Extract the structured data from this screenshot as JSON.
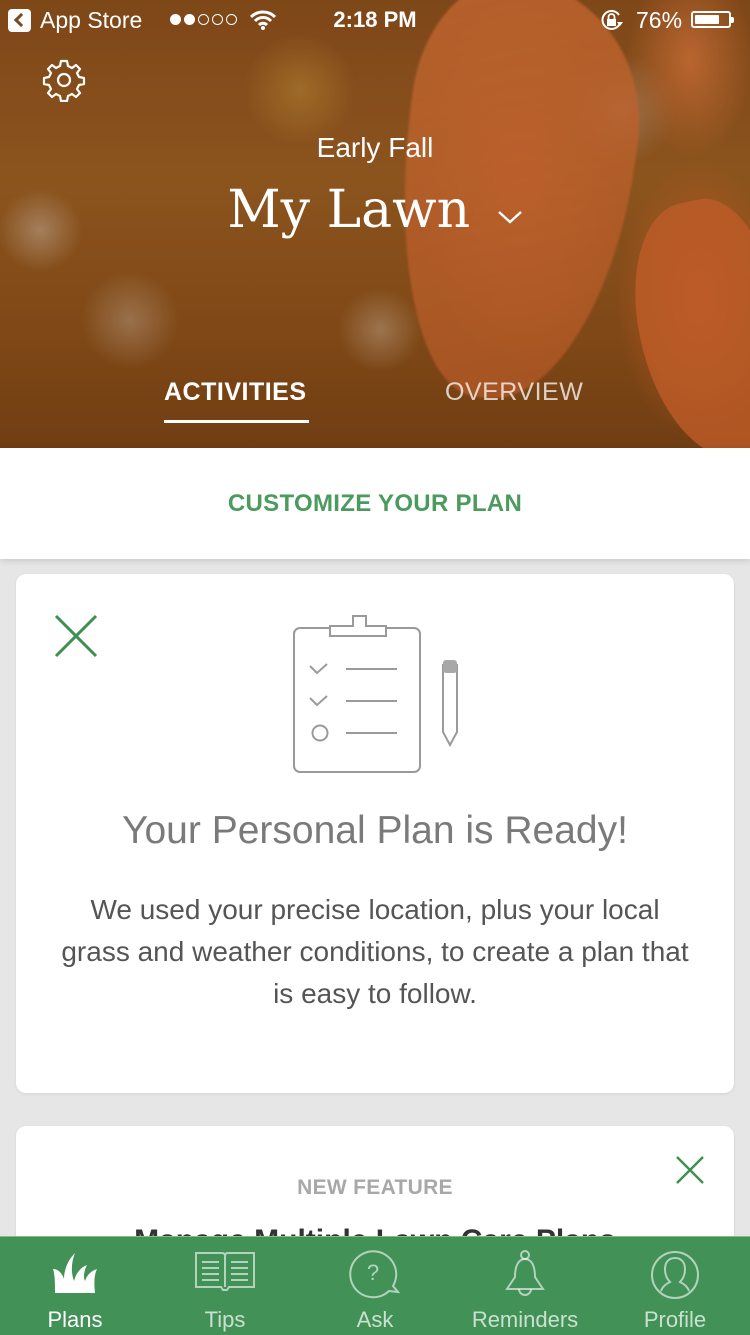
{
  "status_bar": {
    "back_label": "App Store",
    "signal_bars_filled": 2,
    "signal_bars_total": 5,
    "time": "2:18 PM",
    "battery_percent_label": "76%",
    "battery_level": 0.76
  },
  "header": {
    "season": "Early Fall",
    "title": "My Lawn",
    "tabs": [
      {
        "label": "ACTIVITIES",
        "active": true
      },
      {
        "label": "OVERVIEW",
        "active": false
      }
    ]
  },
  "customize_label": "CUSTOMIZE YOUR PLAN",
  "plan_card": {
    "title": "Your Personal Plan is Ready!",
    "body": "We used your precise location, plus your local grass and weather conditions, to create a plan that is easy to follow."
  },
  "feature_card": {
    "label": "NEW FEATURE",
    "title": "Manage Multiple Lawn Care Plans"
  },
  "colors": {
    "accent_green": "#4b9a5e",
    "tabbar_green": "#429157",
    "close_green": "#3f8f50"
  },
  "tabbar": {
    "items": [
      {
        "label": "Plans",
        "icon": "grass-icon",
        "active": true
      },
      {
        "label": "Tips",
        "icon": "book-icon",
        "active": false
      },
      {
        "label": "Ask",
        "icon": "question-bubble-icon",
        "active": false
      },
      {
        "label": "Reminders",
        "icon": "bell-icon",
        "active": false
      },
      {
        "label": "Profile",
        "icon": "profile-icon",
        "active": false
      }
    ]
  }
}
